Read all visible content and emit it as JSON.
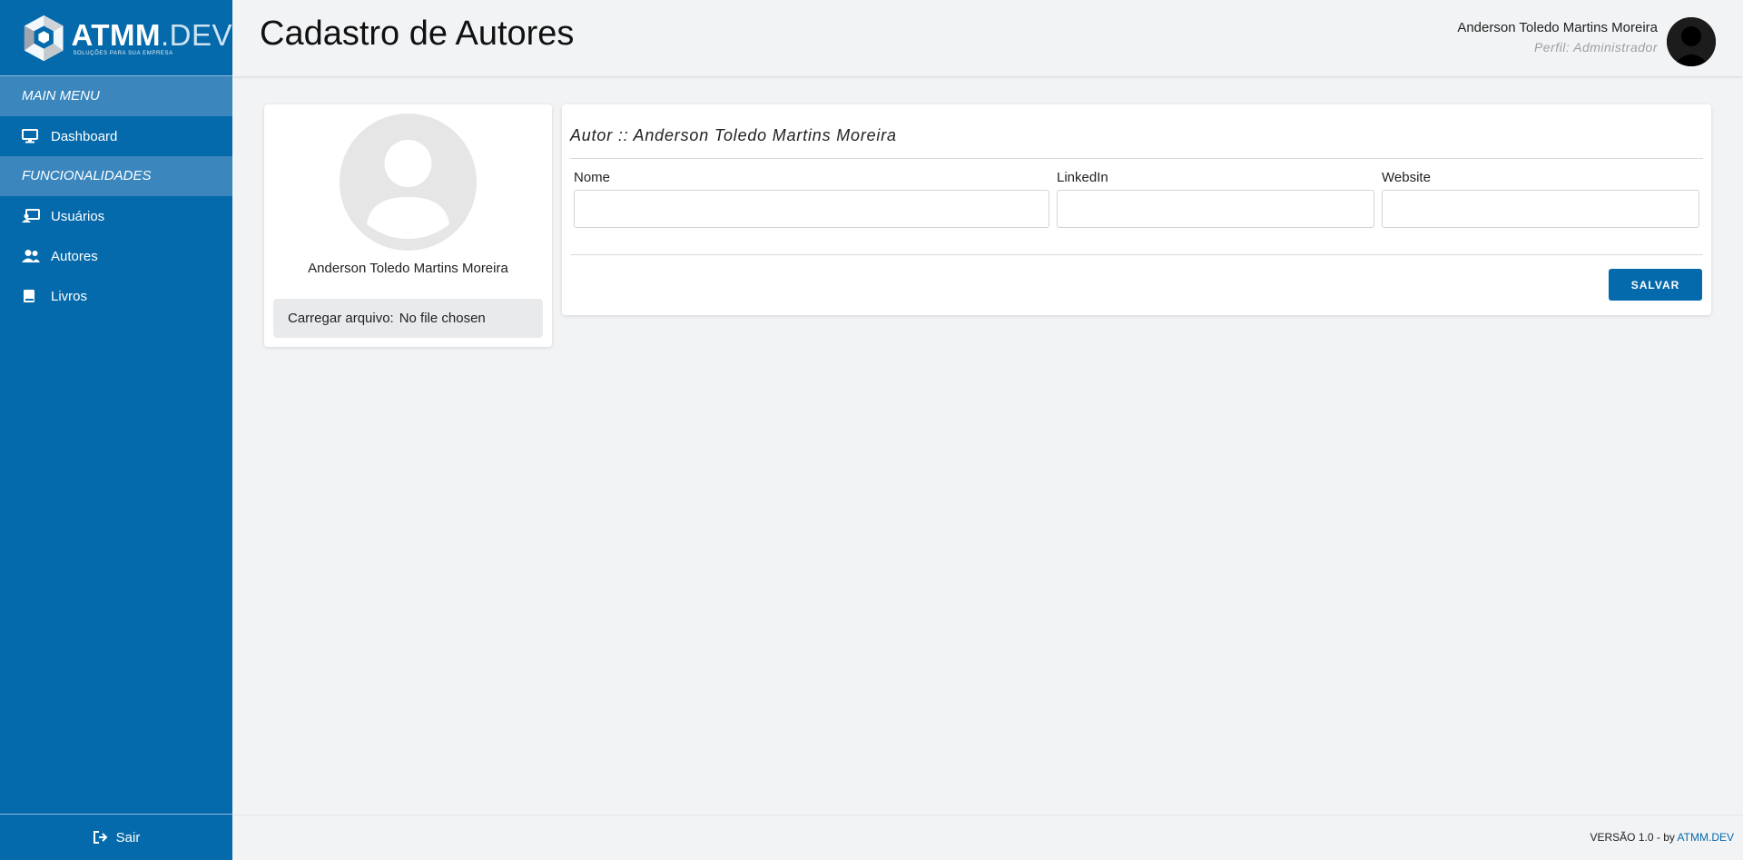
{
  "brand": {
    "name_bold": "ATMM",
    "name_light": ".DEV",
    "tagline": "SOLUÇÕES PARA SUA EMPRESA"
  },
  "sidebar": {
    "sections": [
      {
        "label": "MAIN MENU"
      },
      {
        "label": "FUNCIONALIDADES"
      }
    ],
    "items": [
      {
        "label": "Dashboard",
        "icon": "monitor-icon"
      },
      {
        "label": "Usuários",
        "icon": "users-screen-icon"
      },
      {
        "label": "Autores",
        "icon": "user-group-icon"
      },
      {
        "label": "Livros",
        "icon": "book-icon"
      }
    ],
    "logout": {
      "label": "Sair",
      "icon": "sign-out-icon"
    }
  },
  "header": {
    "title": "Cadastro de Autores",
    "user_name": "Anderson Toledo Martins Moreira",
    "user_role": "Perfil: Administrador"
  },
  "profile": {
    "name": "Anderson Toledo Martins Moreira",
    "file_label": "Carregar arquivo:",
    "file_status": "No file chosen"
  },
  "form": {
    "title": "Autor :: Anderson Toledo Martins Moreira",
    "fields": [
      {
        "label": "Nome",
        "value": ""
      },
      {
        "label": "LinkedIn",
        "value": ""
      },
      {
        "label": "Website",
        "value": ""
      }
    ],
    "save_label": "SALVAR"
  },
  "footer": {
    "version": "VERSÃO 1.0 - by",
    "link": "ATMM.DEV"
  },
  "colors": {
    "primary": "#056aab",
    "section": "#3a86bd",
    "background": "#f2f3f5"
  }
}
